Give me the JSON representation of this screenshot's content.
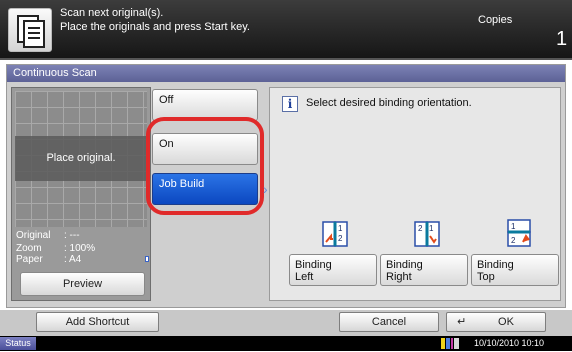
{
  "header": {
    "message_line1": "Scan next original(s).",
    "message_line2": "Place the originals and press Start key.",
    "mode": "Copies",
    "count": "1",
    "icon": "scan-document-icon"
  },
  "panel": {
    "title": "Continuous Scan"
  },
  "preview": {
    "placeholder": "Place original.",
    "original_label": "Original",
    "original_value": ": ---",
    "zoom_label": "Zoom",
    "zoom_value": ": 100%",
    "paper_label": "Paper",
    "paper_value": ": A4",
    "button_label": "Preview"
  },
  "options": [
    {
      "label": "Off",
      "selected": false
    },
    {
      "label": "On",
      "selected": false
    },
    {
      "label": "Job Build",
      "selected": true
    }
  ],
  "binding": {
    "message": "Select desired binding orientation.",
    "left_line1": "Binding",
    "left_line2": "Left",
    "right_line1": "Binding",
    "right_line2": "Right",
    "top_line1": "Binding",
    "top_line2": "Top"
  },
  "bottom": {
    "add_shortcut": "Add Shortcut",
    "cancel": "Cancel",
    "ok": "OK"
  },
  "status": {
    "label": "Status",
    "datetime": "10/10/2010  10:10"
  },
  "colors": {
    "title_bar": "#5c6196",
    "selected_button": "#0b47c0",
    "highlight": "#e02a2a"
  }
}
